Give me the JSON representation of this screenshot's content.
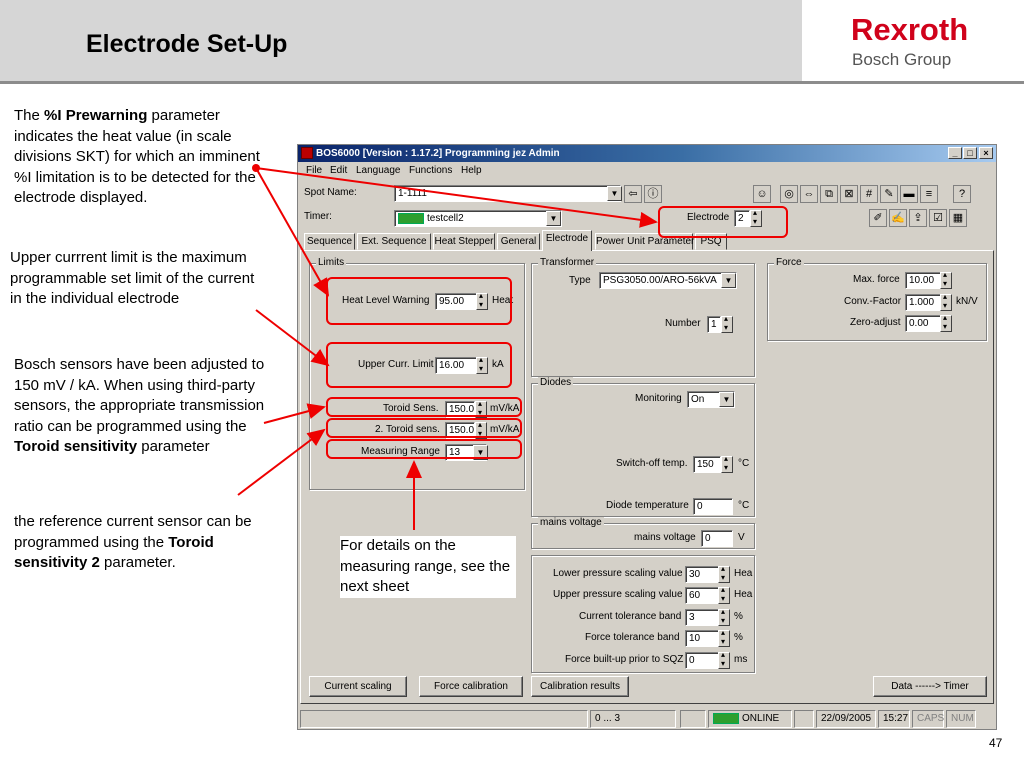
{
  "slide": {
    "title": "Electrode Set-Up",
    "logo_line1": "Rexroth",
    "logo_line2": "Bosch Group",
    "page_number": "47"
  },
  "notes": {
    "n1_pre": "The ",
    "n1_bold": "%I Prewarning",
    "n1_post": " parameter indicates the heat value (in scale divisions SKT) for which an imminent %I limitation is to be detected for the electrode displayed.",
    "n2": "Upper currrent limit is the maximum programmable set limit of the current in the individual electrode",
    "n3_pre": "Bosch sensors have been adjusted to 150 mV / kA. When using third-party sensors, the appropriate transmission ratio can be programmed using the ",
    "n3_bold": "Toroid sensitivity",
    "n3_post": " parameter",
    "n4_pre": "the reference current sensor can be programmed using the ",
    "n4_bold": "Toroid sensitivity 2",
    "n4_post": " parameter.",
    "n5": "For details on the measuring range, see the next sheet"
  },
  "window": {
    "title_version": "BOS6000 [Version : 1.17.2]",
    "title_rest": " Programming jez Admin",
    "controls": [
      "_",
      "□",
      "×"
    ],
    "menu": [
      "File",
      "Edit",
      "Language",
      "Functions",
      "Help"
    ],
    "spot_name_label": "Spot Name:",
    "spot_name_value": "1-1111",
    "timer_label": "Timer:",
    "timer_value": "testcell2",
    "electrode_label": "Electrode",
    "electrode_value": "2",
    "tabs": [
      "Sequence",
      "Ext. Sequence",
      "Heat Stepper",
      "General",
      "Electrode",
      "Power Unit Parameter",
      "PSQ"
    ],
    "limits": {
      "title": "Limits",
      "heat_level_warning_label": "Heat Level Warning",
      "heat_level_warning_value": "95.00",
      "heat_level_warning_unit": "Heat",
      "upper_curr_limit_label": "Upper Curr. Limit",
      "upper_curr_limit_value": "16.00",
      "upper_curr_limit_unit": "kA",
      "toroid_sens_label": "Toroid Sens.",
      "toroid_sens_value": "150.0",
      "toroid_sens_unit": "mV/kA",
      "toroid_sens2_label": "2. Toroid sens.",
      "toroid_sens2_value": "150.0",
      "toroid_sens2_unit": "mV/kA",
      "measuring_range_label": "Measuring Range",
      "measuring_range_value": "13"
    },
    "transformer": {
      "title": "Transformer",
      "type_label": "Type",
      "type_value": "PSG3050.00/ARO-56kVA",
      "number_label": "Number",
      "number_value": "1"
    },
    "diodes": {
      "title": "Diodes",
      "monitoring_label": "Monitoring",
      "monitoring_value": "On",
      "switch_off_label": "Switch-off temp.",
      "switch_off_value": "150",
      "switch_off_unit": "°C",
      "diode_temp_label": "Diode temperature",
      "diode_temp_value": "0",
      "diode_temp_unit": "°C"
    },
    "mains": {
      "title": "mains voltage",
      "label": "mains voltage",
      "value": "0",
      "unit": "V"
    },
    "scaling": {
      "lower_label": "Lower pressure scaling value",
      "lower_value": "30",
      "lower_unit": "Hea",
      "upper_label": "Upper pressure scaling value",
      "upper_value": "60",
      "upper_unit": "Hea",
      "current_tol_label": "Current tolerance band",
      "current_tol_value": "3",
      "current_tol_unit": "%",
      "force_tol_label": "Force tolerance band",
      "force_tol_value": "10",
      "force_tol_unit": "%",
      "force_buildup_label": "Force built-up prior to SQZ",
      "force_buildup_value": "0",
      "force_buildup_unit": "ms"
    },
    "force": {
      "title": "Force",
      "max_force_label": "Max. force",
      "max_force_value": "10.00",
      "conv_factor_label": "Conv.-Factor",
      "conv_factor_value": "1.000",
      "conv_factor_unit": "kN/V",
      "zero_adjust_label": "Zero-adjust",
      "zero_adjust_value": "0.00"
    },
    "buttons": {
      "current_scaling": "Current scaling",
      "force_calibration": "Force calibration",
      "calibration_results": "Calibration results",
      "data_timer": "Data  ------> Timer"
    },
    "status": {
      "range": "0 ... 3",
      "online": "ONLINE",
      "date": "22/09/2005",
      "time": "15:27",
      "caps": "CAPS",
      "num": "NUM"
    }
  },
  "colors": {
    "annotation": "#e00000",
    "title_bar": "#0a246a",
    "logo_red": "#d0021b"
  }
}
